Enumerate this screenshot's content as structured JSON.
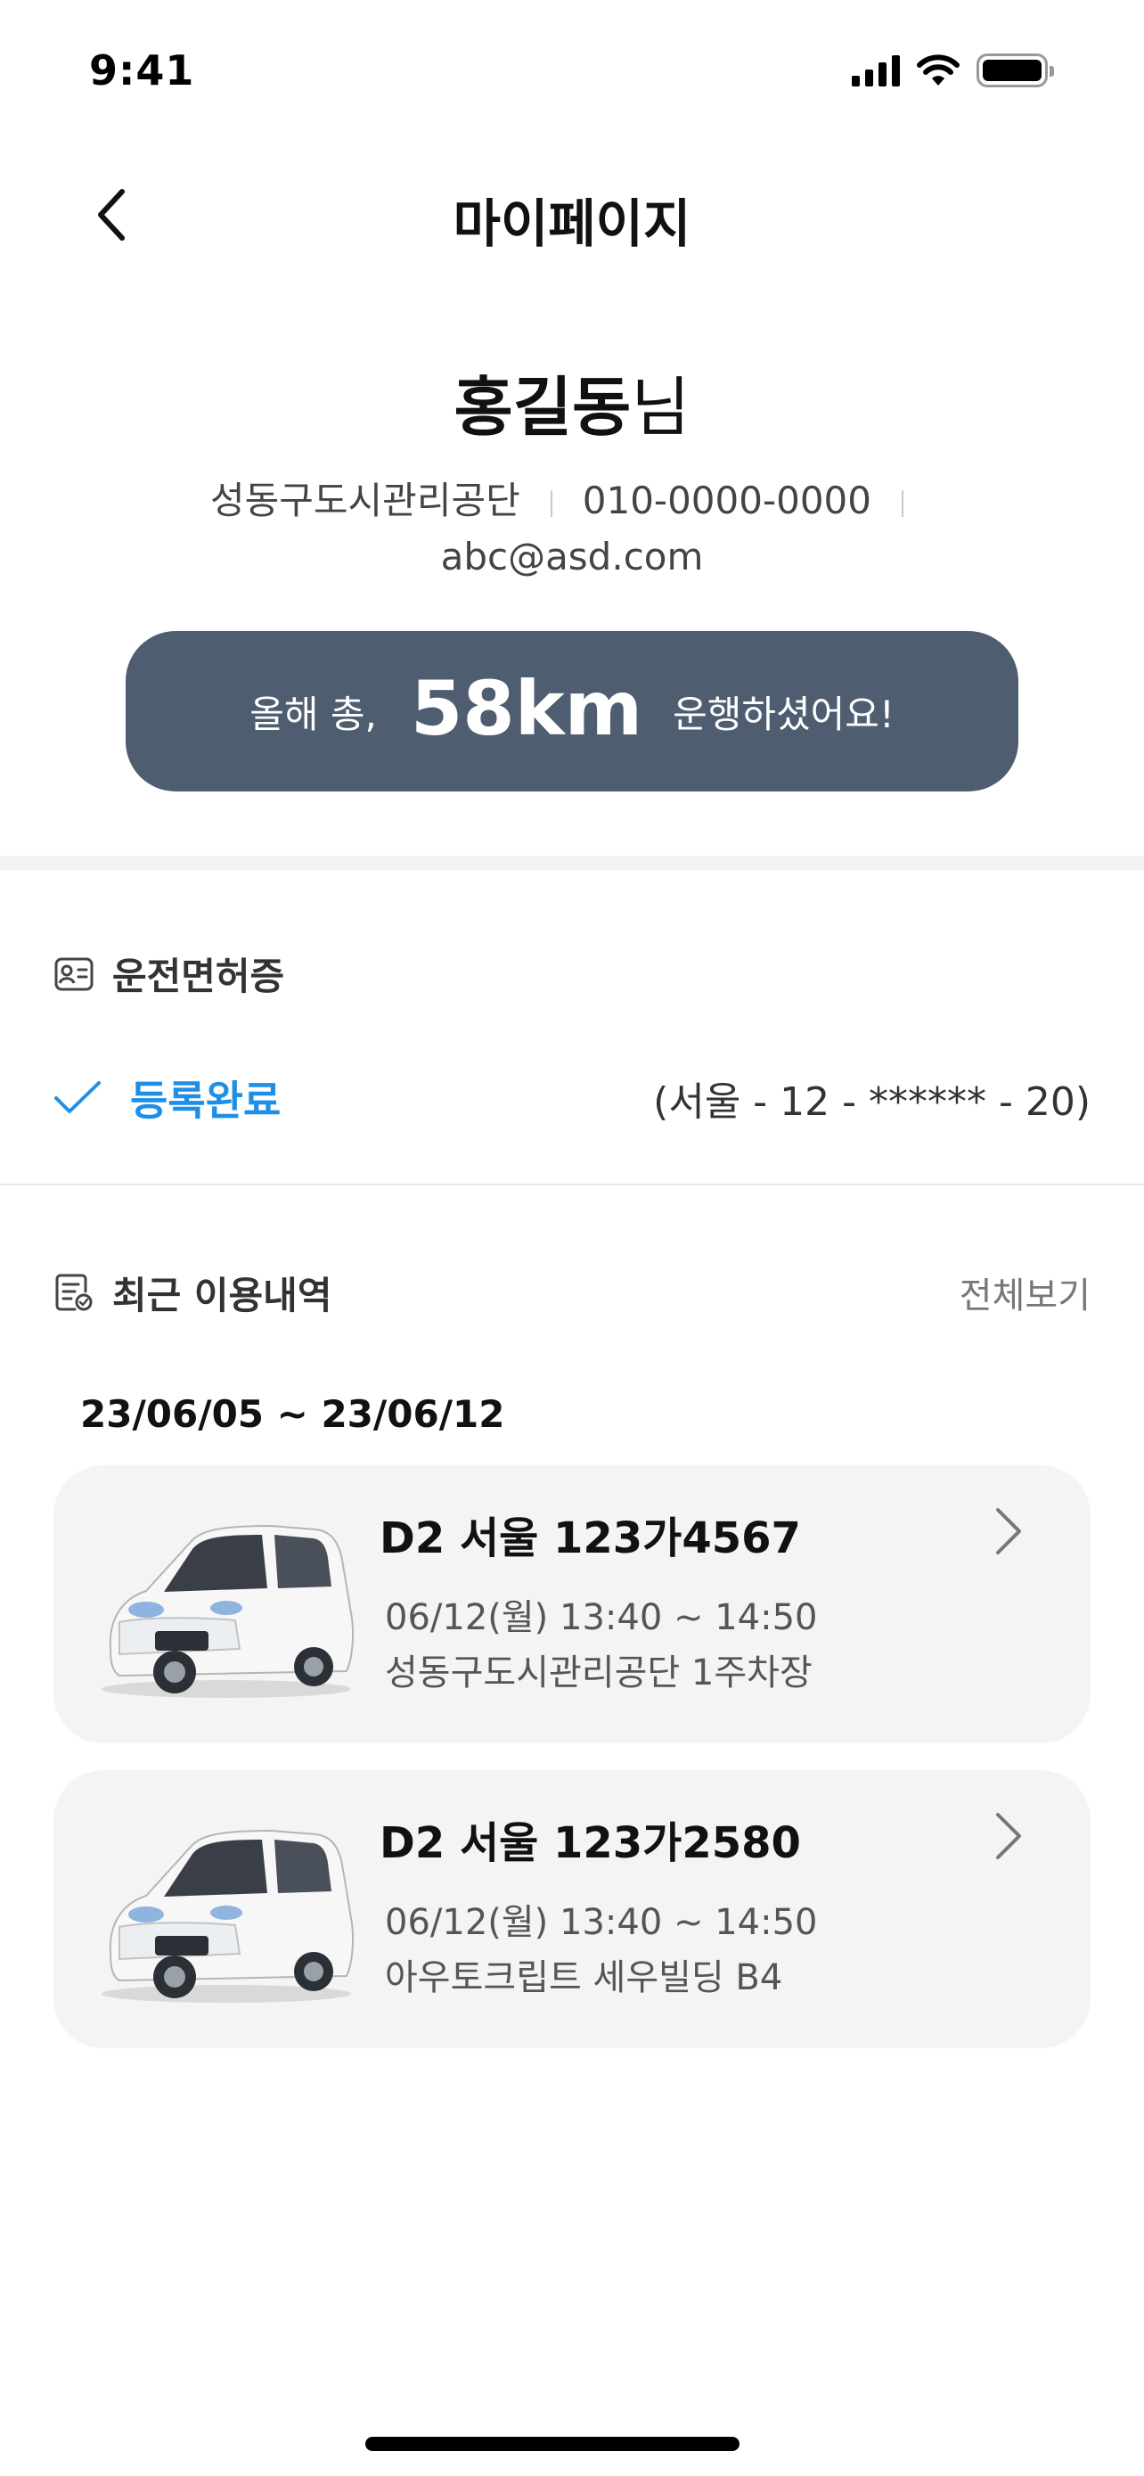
{
  "status_bar": {
    "time": "9:41"
  },
  "header": {
    "title": "마이페이지"
  },
  "profile": {
    "name": "홍길동",
    "name_suffix": "님",
    "organization": "성동구도시관리공단",
    "phone": "010-0000-0000",
    "email": "abc@asd.com"
  },
  "summary": {
    "prefix": "올해 총,",
    "distance": "58km",
    "suffix": "운행하셨어요!"
  },
  "license": {
    "title": "운전면허증",
    "status": "등록완료",
    "number": "(서울 - 12 - ****** - 20)"
  },
  "recent": {
    "title": "최근 이용내역",
    "view_all": "전체보기",
    "date_range": "23/06/05 ~ 23/06/12",
    "items": [
      {
        "title": "D2 서울 123가4567",
        "time": "06/12(월) 13:40 ~ 14:50",
        "place": "성동구도시관리공단 1주차장"
      },
      {
        "title": "D2 서울 123가2580",
        "time": "06/12(월) 13:40 ~ 14:50",
        "place": "아우토크립트 세우빌딩 B4"
      }
    ]
  },
  "colors": {
    "banner": "#4e5d70",
    "accent": "#1e8fe6",
    "card_bg": "#f4f4f4"
  },
  "icons": {
    "back": "chevron-left-icon",
    "license": "id-card-icon",
    "status": "check-icon",
    "recent": "receipt-icon",
    "card": "chevron-right-icon"
  }
}
